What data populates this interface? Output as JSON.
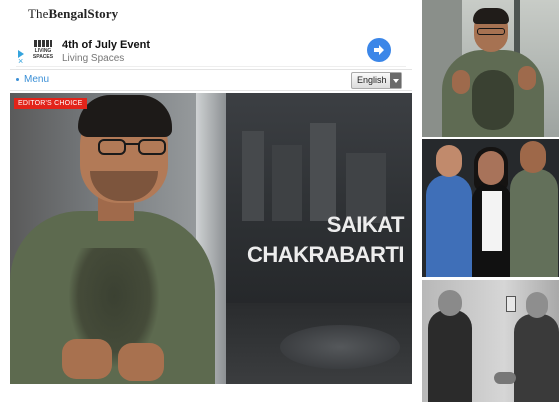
{
  "site": {
    "logo_prefix": "The",
    "logo_main": "BengalStory"
  },
  "ad": {
    "title": "4th of July Event",
    "advertiser": "Living Spaces",
    "logo_text": "LIVING SPACES",
    "adchoices_close": "×",
    "colors": {
      "go_button": "#3b86e8",
      "adchoices": "#35a4dd"
    }
  },
  "nav": {
    "menu_label": "Menu",
    "language_selected": "English"
  },
  "video": {
    "badge": "EDITOR'S CHOICE",
    "overlay_line1": "SAIKAT",
    "overlay_line2": "CHAKRABARTI",
    "colors": {
      "badge": "#e2241a",
      "overlay_text": "#ededed"
    }
  },
  "thumbnails": [
    {
      "description_icon": "video-thumbnail"
    },
    {
      "description_icon": "photo-thumbnail"
    },
    {
      "description_icon": "archival-photo-thumbnail"
    }
  ],
  "colors": {
    "link": "#3a8fd6"
  }
}
